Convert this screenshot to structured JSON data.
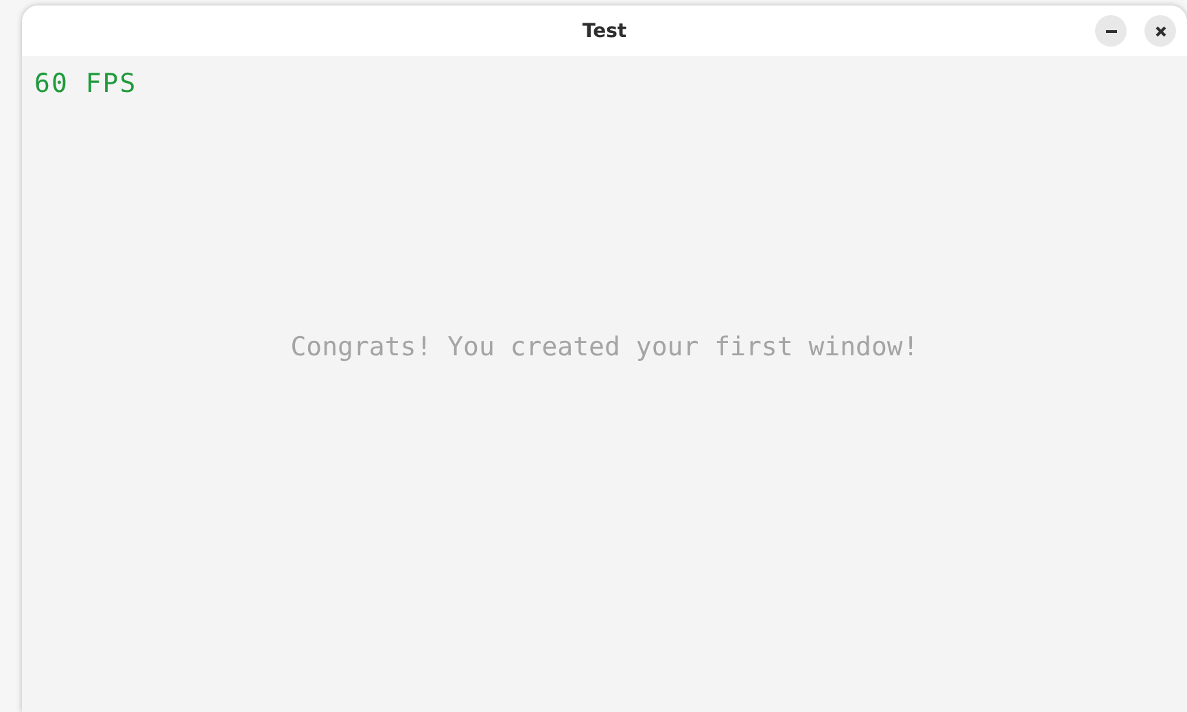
{
  "window": {
    "title": "Test"
  },
  "fps_counter": "60 FPS",
  "message": "Congrats! You created your first window!"
}
